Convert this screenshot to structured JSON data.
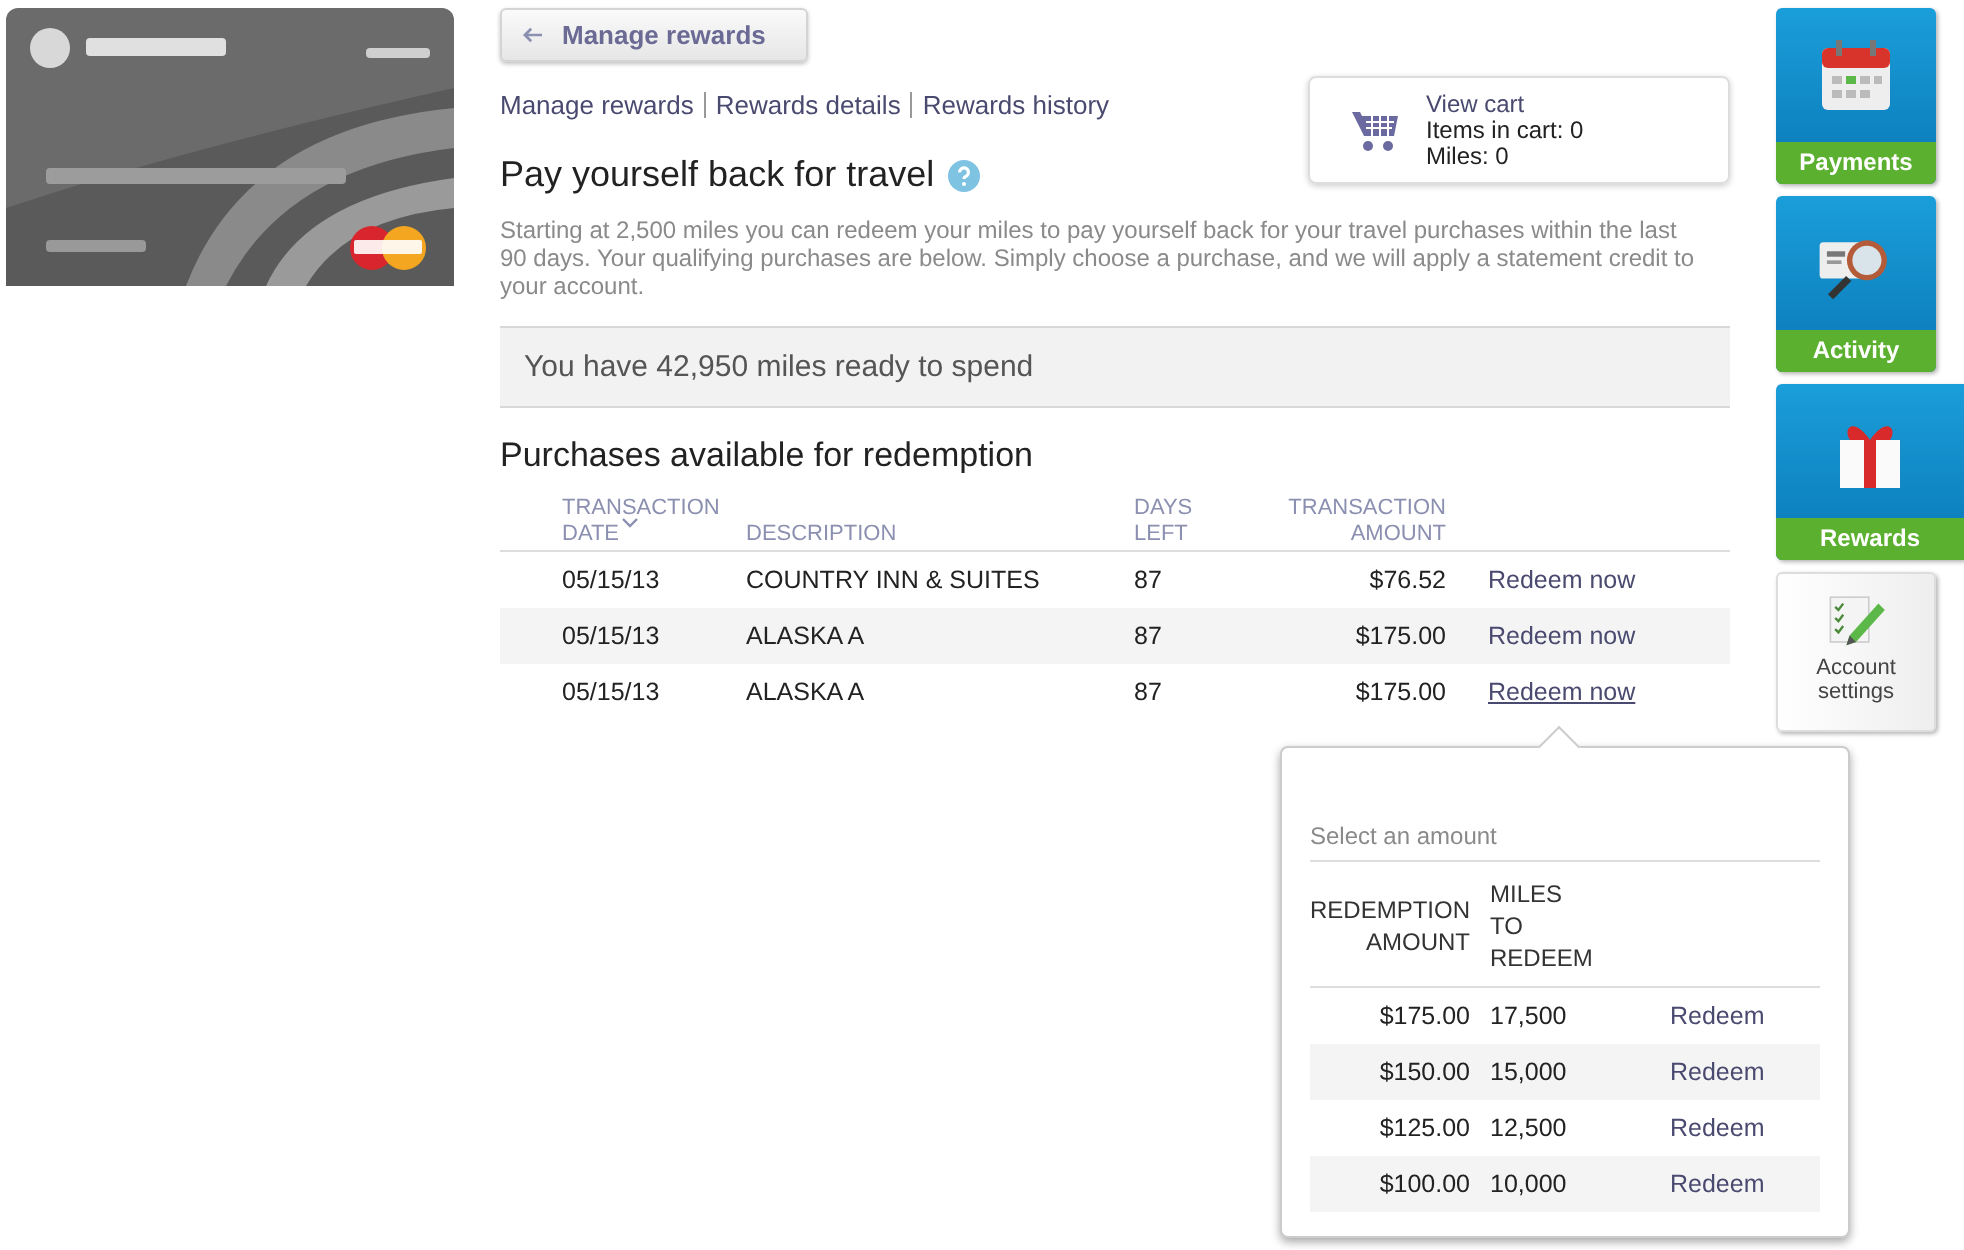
{
  "back_button": {
    "label": "Manage rewards"
  },
  "links": [
    {
      "label": "Manage rewards"
    },
    {
      "label": "Rewards details"
    },
    {
      "label": "Rewards history"
    }
  ],
  "cart": {
    "title": "View cart",
    "items": "Items in cart: 0",
    "miles": "Miles: 0"
  },
  "heading": "Pay yourself back for travel",
  "intro": "Starting at 2,500 miles you can redeem your miles to pay yourself back for your travel purchases within the last 90 days. Your qualifying purchases are below. Simply choose a purchase, and we will apply a statement credit to your account.",
  "miles_banner": "You have 42,950 miles ready to spend",
  "purchases": {
    "title": "Purchases available for redemption",
    "columns": [
      {
        "label": "TRANSACTION DATE",
        "sorted": true
      },
      {
        "label": "DESCRIPTION",
        "sorted": false
      },
      {
        "label": "DAYS LEFT",
        "sorted": false
      },
      {
        "label": "TRANSACTION AMOUNT",
        "sorted": false
      }
    ],
    "rows": [
      {
        "date": "05/15/13",
        "description": "COUNTRY INN & SUITES",
        "days_left": "87",
        "amount": "$76.52",
        "action": "Redeem now",
        "active": false
      },
      {
        "date": "05/15/13",
        "description": "ALASKA A",
        "days_left": "87",
        "amount": "$175.00",
        "action": "Redeem now",
        "active": false
      },
      {
        "date": "05/15/13",
        "description": "ALASKA A",
        "days_left": "87",
        "amount": "$175.00",
        "action": "Redeem now",
        "active": true
      }
    ]
  },
  "popover": {
    "title": "Select an amount",
    "columns": [
      "REDEMPTION AMOUNT",
      "MILES TO REDEEM"
    ],
    "rows": [
      {
        "amount": "$175.00",
        "miles": "17,500",
        "action": "Redeem"
      },
      {
        "amount": "$150.00",
        "miles": "15,000",
        "action": "Redeem"
      },
      {
        "amount": "$125.00",
        "miles": "12,500",
        "action": "Redeem"
      },
      {
        "amount": "$100.00",
        "miles": "10,000",
        "action": "Redeem"
      }
    ]
  },
  "nav": [
    {
      "kind": "calendar",
      "label": "Payments",
      "selected": false
    },
    {
      "kind": "activity",
      "label": "Activity",
      "selected": false
    },
    {
      "kind": "gift",
      "label": "Rewards",
      "selected": true
    },
    {
      "kind": "settings",
      "label": "Account settings",
      "selected": false
    }
  ]
}
